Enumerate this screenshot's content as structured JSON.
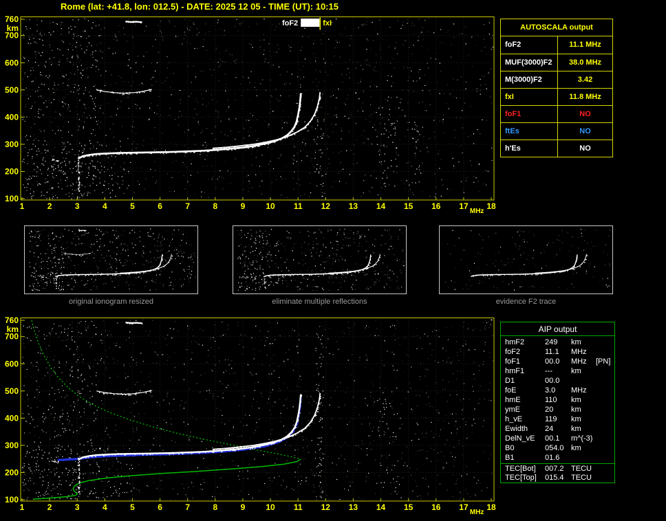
{
  "title": "Rome (lat: +41.8, lon: 012.5) - DATE: 2025 12 05 - TIME (UT): 10:15",
  "colors": {
    "axis_text": "#ffff00",
    "plot_border": "#c9c900",
    "autoscala_border": "#d6d600",
    "aip_border": "#00aa00",
    "profile_green": "#00bb00",
    "restored_blue": "#2233dd",
    "trace_white": "#ffffff"
  },
  "autoscala": {
    "header": "AUTOSCALA output",
    "rows": [
      {
        "label": "foF2",
        "value": "11.1 MHz",
        "label_color": "#ffffff",
        "value_color": "#ffff00"
      },
      {
        "label": "MUF(3000)F2",
        "value": "38.0 MHz",
        "label_color": "#ffffff",
        "value_color": "#ffff00"
      },
      {
        "label": "M(3000)F2",
        "value": "3.42",
        "label_color": "#ffffff",
        "value_color": "#ffff00"
      },
      {
        "label": "fxI",
        "value": "11.8 MHz",
        "label_color": "#ffff00",
        "value_color": "#ffff00"
      },
      {
        "label": "foF1",
        "value": "NO",
        "label_color": "#ff2020",
        "value_color": "#ff2020"
      },
      {
        "label": "ftEs",
        "value": "NO",
        "label_color": "#3399ff",
        "value_color": "#3399ff"
      },
      {
        "label": "h'Es",
        "value": "NO",
        "label_color": "#ffffff",
        "value_color": "#ffffff"
      }
    ]
  },
  "thumbnails": [
    {
      "caption": "original ionogram resized"
    },
    {
      "caption": "eliminate multiple reflections"
    },
    {
      "caption": "evidence F2 trace"
    }
  ],
  "aip": {
    "header": "AIP output",
    "rows": [
      {
        "label": "hmF2",
        "value": "249",
        "unit": "km",
        "extra": ""
      },
      {
        "label": "foF2",
        "value": "11.1",
        "unit": "MHz",
        "extra": ""
      },
      {
        "label": "foF1",
        "value": "00.0",
        "unit": "MHz",
        "extra": "[PN]"
      },
      {
        "label": "hmF1",
        "value": "---",
        "unit": "km",
        "extra": ""
      },
      {
        "label": "D1",
        "value": "00.0",
        "unit": "",
        "extra": ""
      },
      {
        "label": "foE",
        "value": "3.0",
        "unit": "MHz",
        "extra": ""
      },
      {
        "label": "hmE",
        "value": "110",
        "unit": "km",
        "extra": ""
      },
      {
        "label": "ymE",
        "value": "20",
        "unit": "km",
        "extra": ""
      },
      {
        "label": "h_vE",
        "value": "119",
        "unit": "km",
        "extra": ""
      },
      {
        "label": "Ewidth",
        "value": "24",
        "unit": "km",
        "extra": ""
      },
      {
        "label": "DelN_vE",
        "value": "00.1",
        "unit": "m^(-3)",
        "extra": ""
      },
      {
        "label": "B0",
        "value": "054.0",
        "unit": "km",
        "extra": ""
      },
      {
        "label": "B1",
        "value": "01.6",
        "unit": "",
        "extra": ""
      },
      {
        "label": "TEC[Bot]",
        "value": "007.2",
        "unit": "TECU",
        "extra": "",
        "sep_before": true
      },
      {
        "label": "TEC[Top]",
        "value": "015.4",
        "unit": "TECU",
        "extra": ""
      }
    ]
  },
  "chart_data": [
    {
      "id": "ionogram-top",
      "type": "scatter",
      "title": "ionogram with autoscaled critical frequencies",
      "xlabel": "MHz",
      "ylabel": "km",
      "xlim": [
        1,
        18
      ],
      "ylim": [
        100,
        760
      ],
      "x_ticks": [
        1,
        2,
        3,
        4,
        5,
        6,
        7,
        8,
        9,
        10,
        11,
        12,
        13,
        14,
        15,
        16,
        17,
        18
      ],
      "y_ticks": [
        100,
        200,
        300,
        400,
        500,
        600,
        700,
        760
      ],
      "grid": true,
      "annotations": [
        {
          "label": "foF2",
          "freq": 11.1,
          "color": "#ffffff"
        },
        {
          "label": "fxI",
          "freq": 11.8,
          "color": "#ffff00"
        }
      ],
      "series": [
        {
          "name": "leading-trace",
          "color": "#ffffff",
          "lw": 0,
          "spread": 2,
          "density": 1.2,
          "points": [
            [
              2.05,
              245
            ],
            [
              2.2,
              242
            ],
            [
              2.35,
              240
            ]
          ]
        },
        {
          "name": "F2-O-trace",
          "color": "#ffffff",
          "lw": 2.6,
          "spread": 3,
          "density": 1.1,
          "points": [
            [
              3.05,
              248
            ],
            [
              3.2,
              256
            ],
            [
              3.45,
              261
            ],
            [
              3.7,
              264
            ],
            [
              4.0,
              266
            ],
            [
              4.5,
              268
            ],
            [
              5.0,
              269
            ],
            [
              5.5,
              270
            ],
            [
              6.0,
              271
            ],
            [
              6.5,
              272
            ],
            [
              7.0,
              274
            ],
            [
              7.5,
              276
            ],
            [
              8.0,
              279
            ],
            [
              8.5,
              283
            ],
            [
              9.0,
              288
            ],
            [
              9.4,
              294
            ],
            [
              9.8,
              302
            ],
            [
              10.1,
              310
            ],
            [
              10.4,
              321
            ],
            [
              10.6,
              333
            ],
            [
              10.75,
              347
            ],
            [
              10.87,
              364
            ],
            [
              10.95,
              385
            ],
            [
              11.0,
              408
            ],
            [
              11.05,
              435
            ],
            [
              11.08,
              462
            ],
            [
              11.1,
              488
            ]
          ]
        },
        {
          "name": "F2-X-trace",
          "color": "#ffffff",
          "lw": 1.8,
          "spread": 2.5,
          "density": 0.9,
          "points": [
            [
              7.9,
              285
            ],
            [
              8.4,
              289
            ],
            [
              8.9,
              294
            ],
            [
              9.4,
              300
            ],
            [
              9.8,
              307
            ],
            [
              10.2,
              316
            ],
            [
              10.6,
              328
            ],
            [
              10.95,
              344
            ],
            [
              11.25,
              363
            ],
            [
              11.45,
              385
            ],
            [
              11.6,
              410
            ],
            [
              11.7,
              438
            ],
            [
              11.77,
              468
            ],
            [
              11.8,
              492
            ]
          ]
        },
        {
          "name": "second-hop-multiple",
          "color": "#ffffff",
          "lw": 1.2,
          "spread": 3,
          "density": 0.8,
          "points": [
            [
              3.7,
              500
            ],
            [
              4.0,
              494
            ],
            [
              4.35,
              490
            ],
            [
              4.7,
              488
            ],
            [
              5.05,
              490
            ],
            [
              5.4,
              495
            ],
            [
              5.7,
              502
            ]
          ]
        },
        {
          "name": "E-region-vertical",
          "color": "#ffffff",
          "lw": 0,
          "spread": 3,
          "density": 1.6,
          "points": [
            [
              3.02,
              258
            ],
            [
              3.05,
              238
            ],
            [
              3.03,
              218
            ],
            [
              3.06,
              198
            ],
            [
              3.04,
              178
            ],
            [
              3.06,
              158
            ],
            [
              3.04,
              140
            ],
            [
              3.06,
              124
            ]
          ]
        },
        {
          "name": "top-marks",
          "color": "#ffffff",
          "lw": 2.2,
          "spread": 1.5,
          "density": 0.8,
          "points": [
            [
              4.75,
              752
            ],
            [
              4.95,
              750
            ],
            [
              5.15,
              751
            ],
            [
              5.35,
              749
            ]
          ]
        }
      ]
    },
    {
      "id": "ionogram-bottom",
      "type": "scatter",
      "title": "ionogram with restored trace and electron density profile",
      "xlabel": "MHz",
      "ylabel": "km",
      "xlim": [
        1,
        18
      ],
      "ylim": [
        100,
        760
      ],
      "x_ticks": [
        1,
        2,
        3,
        4,
        5,
        6,
        7,
        8,
        9,
        10,
        11,
        12,
        13,
        14,
        15,
        16,
        17,
        18
      ],
      "y_ticks": [
        100,
        200,
        300,
        400,
        500,
        600,
        700,
        760
      ],
      "grid": true,
      "series": [
        {
          "name": "profile-topside",
          "color": "#00bb00",
          "lw": 1.3,
          "dash": "2,3",
          "density": 0,
          "points": [
            [
              1.35,
              760
            ],
            [
              1.45,
              720
            ],
            [
              1.6,
              675
            ],
            [
              1.8,
              630
            ],
            [
              2.05,
              585
            ],
            [
              2.35,
              545
            ],
            [
              2.7,
              510
            ],
            [
              3.1,
              478
            ],
            [
              3.6,
              448
            ],
            [
              4.2,
              420
            ],
            [
              4.9,
              394
            ],
            [
              5.7,
              369
            ],
            [
              6.6,
              345
            ],
            [
              7.6,
              322
            ],
            [
              8.6,
              301
            ],
            [
              9.5,
              283
            ],
            [
              10.3,
              268
            ],
            [
              10.8,
              257
            ],
            [
              11.1,
              249
            ]
          ]
        },
        {
          "name": "profile-bottomside",
          "color": "#00bb00",
          "lw": 1.5,
          "density": 0,
          "points": [
            [
              11.1,
              249
            ],
            [
              10.95,
              240
            ],
            [
              10.5,
              231
            ],
            [
              9.7,
              222
            ],
            [
              8.6,
              213
            ],
            [
              7.3,
              204
            ],
            [
              6.0,
              196
            ],
            [
              4.9,
              188
            ],
            [
              4.0,
              179
            ],
            [
              3.4,
              170
            ],
            [
              3.05,
              160
            ],
            [
              2.9,
              150
            ],
            [
              2.85,
              140
            ],
            [
              2.9,
              131
            ],
            [
              3.0,
              122
            ],
            [
              2.95,
              116
            ],
            [
              2.6,
              111
            ],
            [
              2.0,
              106
            ],
            [
              1.4,
              102
            ]
          ]
        },
        {
          "name": "restored-trace",
          "color": "#2233dd",
          "lw": 3.2,
          "spread": 2,
          "density": 0.5,
          "points": [
            [
              2.3,
              246
            ],
            [
              3.0,
              250
            ],
            [
              3.5,
              256
            ],
            [
              4.0,
              260
            ],
            [
              5.0,
              264
            ],
            [
              6.0,
              267
            ],
            [
              7.0,
              270
            ],
            [
              8.0,
              275
            ],
            [
              9.0,
              284
            ],
            [
              9.8,
              297
            ],
            [
              10.3,
              312
            ],
            [
              10.6,
              329
            ],
            [
              10.8,
              349
            ],
            [
              10.95,
              377
            ],
            [
              11.02,
              409
            ],
            [
              11.07,
              444
            ],
            [
              11.1,
              478
            ]
          ]
        },
        {
          "name": "leading-trace",
          "color": "#ffffff",
          "lw": 0,
          "spread": 2,
          "density": 1.2,
          "points": [
            [
              2.05,
              245
            ],
            [
              2.2,
              242
            ],
            [
              2.35,
              240
            ]
          ]
        },
        {
          "name": "F2-O-trace",
          "color": "#ffffff",
          "lw": 2.4,
          "spread": 3,
          "density": 1.0,
          "points": [
            [
              3.05,
              248
            ],
            [
              3.2,
              256
            ],
            [
              3.45,
              261
            ],
            [
              3.7,
              264
            ],
            [
              4.0,
              266
            ],
            [
              4.5,
              268
            ],
            [
              5.0,
              269
            ],
            [
              5.5,
              270
            ],
            [
              6.0,
              271
            ],
            [
              6.5,
              272
            ],
            [
              7.0,
              274
            ],
            [
              7.5,
              276
            ],
            [
              8.0,
              279
            ],
            [
              8.5,
              283
            ],
            [
              9.0,
              288
            ],
            [
              9.4,
              294
            ],
            [
              9.8,
              302
            ],
            [
              10.1,
              310
            ],
            [
              10.4,
              321
            ],
            [
              10.6,
              333
            ],
            [
              10.75,
              347
            ],
            [
              10.87,
              364
            ],
            [
              10.95,
              385
            ],
            [
              11.0,
              408
            ],
            [
              11.05,
              435
            ],
            [
              11.08,
              462
            ],
            [
              11.1,
              488
            ]
          ]
        },
        {
          "name": "F2-X-trace",
          "color": "#ffffff",
          "lw": 1.8,
          "spread": 2.5,
          "density": 0.9,
          "points": [
            [
              7.9,
              285
            ],
            [
              8.4,
              289
            ],
            [
              8.9,
              294
            ],
            [
              9.4,
              300
            ],
            [
              9.8,
              307
            ],
            [
              10.2,
              316
            ],
            [
              10.6,
              328
            ],
            [
              10.95,
              344
            ],
            [
              11.25,
              363
            ],
            [
              11.45,
              385
            ],
            [
              11.6,
              410
            ],
            [
              11.7,
              438
            ],
            [
              11.77,
              468
            ],
            [
              11.8,
              492
            ]
          ]
        },
        {
          "name": "second-hop-multiple",
          "color": "#ffffff",
          "lw": 1.2,
          "spread": 3,
          "density": 0.8,
          "points": [
            [
              3.7,
              500
            ],
            [
              4.0,
              494
            ],
            [
              4.35,
              490
            ],
            [
              4.7,
              488
            ],
            [
              5.05,
              490
            ],
            [
              5.4,
              495
            ],
            [
              5.7,
              502
            ]
          ]
        },
        {
          "name": "E-region-vertical",
          "color": "#ffffff",
          "lw": 0,
          "spread": 3,
          "density": 1.6,
          "points": [
            [
              3.02,
              258
            ],
            [
              3.05,
              238
            ],
            [
              3.03,
              218
            ],
            [
              3.06,
              198
            ],
            [
              3.04,
              178
            ],
            [
              3.06,
              158
            ],
            [
              3.04,
              140
            ],
            [
              3.06,
              124
            ]
          ]
        },
        {
          "name": "top-marks",
          "color": "#ffffff",
          "lw": 2.2,
          "spread": 1.5,
          "density": 0.8,
          "points": [
            [
              4.75,
              752
            ],
            [
              4.95,
              750
            ],
            [
              5.15,
              751
            ],
            [
              5.35,
              749
            ]
          ]
        }
      ]
    }
  ]
}
